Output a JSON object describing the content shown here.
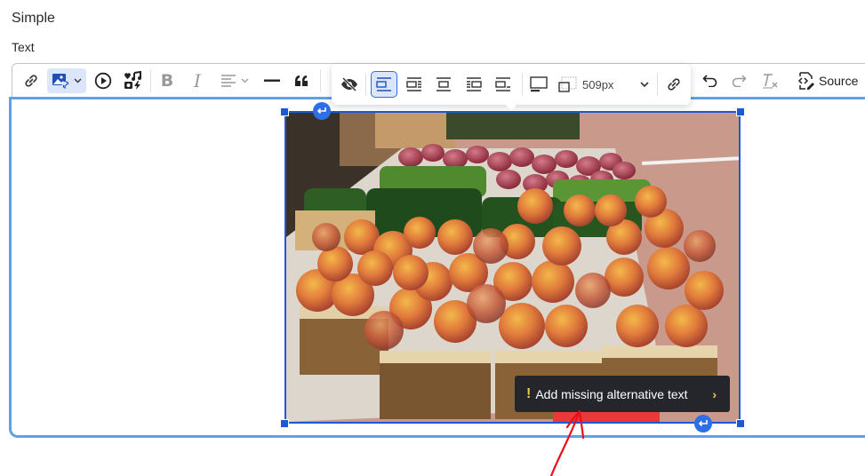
{
  "page": {
    "title": "Simple",
    "field_label": "Text"
  },
  "toolbar": {
    "items": [
      {
        "name": "link",
        "label": "Link",
        "icon": "link-icon"
      },
      {
        "name": "insert-image",
        "label": "Insert image",
        "icon": "image-link-icon",
        "active": true,
        "dropdown": true
      },
      {
        "name": "media-embed",
        "label": "Insert media",
        "icon": "play-circle-icon"
      },
      {
        "name": "media-library",
        "label": "Media library",
        "icon": "media-icon"
      },
      {
        "name": "bold",
        "label": "Bold",
        "icon": "bold-icon",
        "disabled": true
      },
      {
        "name": "italic",
        "label": "Italic",
        "icon": "italic-icon",
        "disabled": true
      },
      {
        "name": "alignment",
        "label": "Text alignment",
        "icon": "align-left-icon",
        "disabled": true,
        "dropdown": true
      },
      {
        "name": "horizontal-line",
        "label": "Horizontal line",
        "icon": "horizontal-line-icon"
      },
      {
        "name": "block-quote",
        "label": "Block quote",
        "icon": "quote-icon"
      },
      {
        "name": "undo",
        "label": "Undo",
        "icon": "undo-icon"
      },
      {
        "name": "redo",
        "label": "Redo",
        "icon": "redo-icon",
        "disabled": true
      },
      {
        "name": "remove-format",
        "label": "Remove format",
        "icon": "remove-format-icon",
        "disabled": true
      }
    ],
    "source_label": "Source"
  },
  "image_toolbar": {
    "items": [
      {
        "name": "toggle-decorative",
        "icon": "eye-slash-icon"
      },
      {
        "name": "align-inline",
        "icon": "image-inline-icon",
        "active": true
      },
      {
        "name": "wrap-left",
        "icon": "wrap-left-icon"
      },
      {
        "name": "break-text",
        "icon": "break-text-icon"
      },
      {
        "name": "wrap-right",
        "icon": "wrap-right-icon"
      },
      {
        "name": "align-block-left",
        "icon": "align-block-left-icon"
      },
      {
        "name": "toggle-caption",
        "icon": "caption-icon"
      },
      {
        "name": "resize",
        "icon": "resize-icon"
      },
      {
        "name": "link-image",
        "icon": "link-icon"
      }
    ],
    "resize_value": "509px"
  },
  "image": {
    "description": "Farmers market stand with baskets of peaches, green peppers, green beans and red potatoes"
  },
  "alt_balloon": {
    "warning_mark": "!",
    "text": "Add missing alternative text",
    "chevron": "›"
  },
  "colors": {
    "accent": "#2f6fe6",
    "selection_border": "#1a5ad6",
    "editor_focus": "#5fa0ec",
    "balloon_bg": "#24262b",
    "warning": "#f2c94c",
    "annotation": "#e8101a"
  }
}
